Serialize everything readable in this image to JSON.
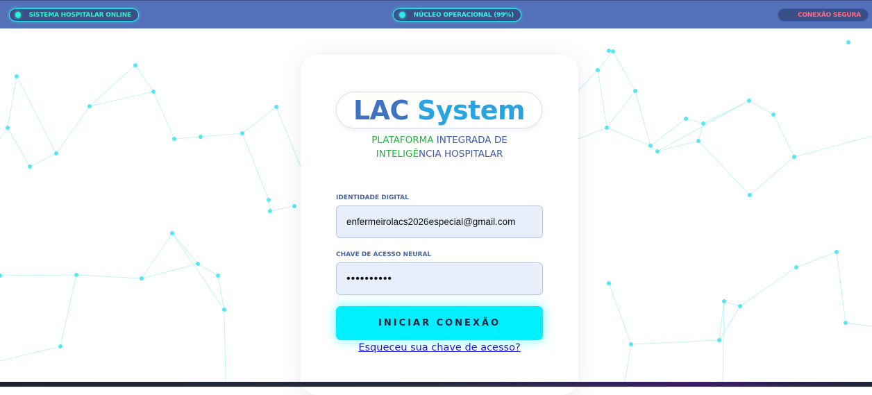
{
  "status_bar": {
    "system_status": "SISTEMA HOSPITALAR ONLINE",
    "core_status": "NÚCLEO OPERACIONAL (99%)",
    "connection_status": "CONEXÃO SEGURA"
  },
  "login": {
    "logo_part1": "LAC",
    "logo_part2": "System",
    "subtitle_line1_green": "PLATAFORMA",
    "subtitle_line1_rest": "INTEGRADA DE",
    "subtitle_line2_green": "INTELIGÊ",
    "subtitle_line2_rest": "NCIA HOSPITALAR",
    "identity_label": "IDENTIDADE DIGITAL",
    "identity_value": "enfermeirolacs2026especial@gmail.com",
    "key_label": "CHAVE DE ACESSO NEURAL",
    "key_value": "••••••••••",
    "submit_label": "INICIAR CONEXÃO",
    "forgot_link": "Esqueceu sua chave de acesso?"
  },
  "colors": {
    "topbar": "#5470b8",
    "accent_cyan": "#00f0ff",
    "status_green": "#37f0c8",
    "status_red": "#ff6b8a",
    "logo_blue": "#3f73c2",
    "logo_light_blue": "#2aa4e0",
    "subtitle_green": "#23b540"
  }
}
